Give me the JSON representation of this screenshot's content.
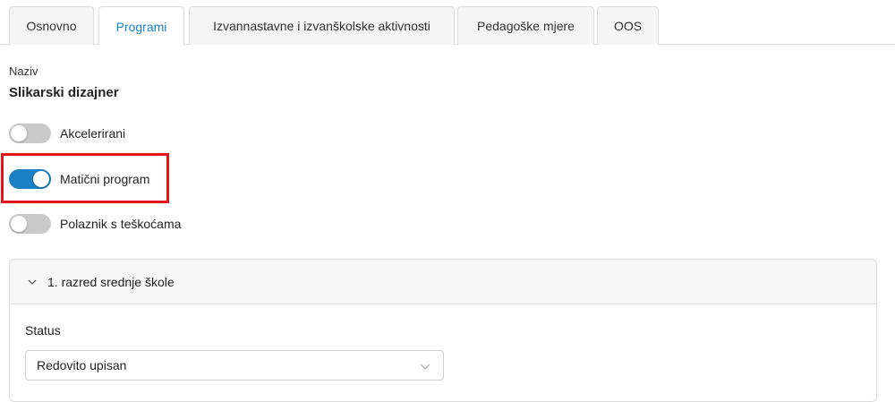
{
  "tabs": [
    {
      "label": "Osnovno",
      "active": false
    },
    {
      "label": "Programi",
      "active": true
    },
    {
      "label": "Izvannastavne i izvanškolske aktivnosti",
      "active": false
    },
    {
      "label": "Pedagoške mjere",
      "active": false
    },
    {
      "label": "OOS",
      "active": false
    }
  ],
  "naziv": {
    "label": "Naziv",
    "value": "Slikarski dizajner"
  },
  "toggles": {
    "akcelerirani": {
      "label": "Akcelerirani",
      "on": false
    },
    "maticni": {
      "label": "Matični program",
      "on": true
    },
    "polaznik": {
      "label": "Polaznik s teškoćama",
      "on": false
    }
  },
  "panel": {
    "title": "1. razred srednje škole",
    "status_label": "Status",
    "status_value": "Redovito upisan"
  },
  "colors": {
    "accent": "#1a7fc4",
    "highlight": "#e3151b"
  }
}
